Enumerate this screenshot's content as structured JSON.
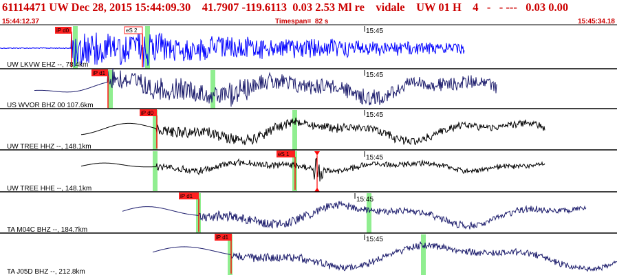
{
  "header": {
    "title": "61114471 UW Dec 28, 2015 15:44:09.30    41.7907 -119.6113  0.03 2.53 Ml re    vidale    UW 01 H    4   -   - ---   0.03 0.00",
    "start_time": "15:44:12.37",
    "timespan": "Timespan=  82 s",
    "end_time": "15:45:34.18"
  },
  "colors": {
    "header_text": "#cc0000",
    "pick_box": "#ff2020",
    "pick_line": "#ff0000",
    "window_mark": "#90ee90",
    "trace_blue": "#0000ff",
    "trace_navy": "#1c1c6c",
    "trace_black": "#000000",
    "panel_border": "#000000"
  },
  "panels": [
    {
      "station": "UW LKVW EHZ --, 78.4km",
      "time_tick": "15:45",
      "trace_color": "blue",
      "picks": [
        {
          "label": "iP d0",
          "style": "filled"
        },
        {
          "label": "eS 2",
          "style": "outline"
        }
      ]
    },
    {
      "station": "US WVOR BHZ 00 107.6km",
      "time_tick": "15:45",
      "trace_color": "navy",
      "picks": [
        {
          "label": "iP d1",
          "style": "filled"
        }
      ]
    },
    {
      "station": "UW TREE HHZ --, 148.1km",
      "time_tick": "15:45",
      "trace_color": "black",
      "picks": [
        {
          "label": "iP d0",
          "style": "filled"
        }
      ]
    },
    {
      "station": "UW TREE HHE --, 148.1km",
      "time_tick": "15:45",
      "trace_color": "black",
      "picks": [
        {
          "label": "eS 1",
          "style": "filled"
        }
      ]
    },
    {
      "station": "TA M04C BHZ --, 184.7km",
      "time_tick": "15:45",
      "trace_color": "navy",
      "picks": [
        {
          "label": "iP d1",
          "style": "filled"
        }
      ]
    },
    {
      "station": "TA J05D BHZ --, 212.8km",
      "time_tick": "15:45",
      "trace_color": "navy",
      "picks": [
        {
          "label": "iP d1",
          "style": "filled"
        }
      ]
    }
  ]
}
